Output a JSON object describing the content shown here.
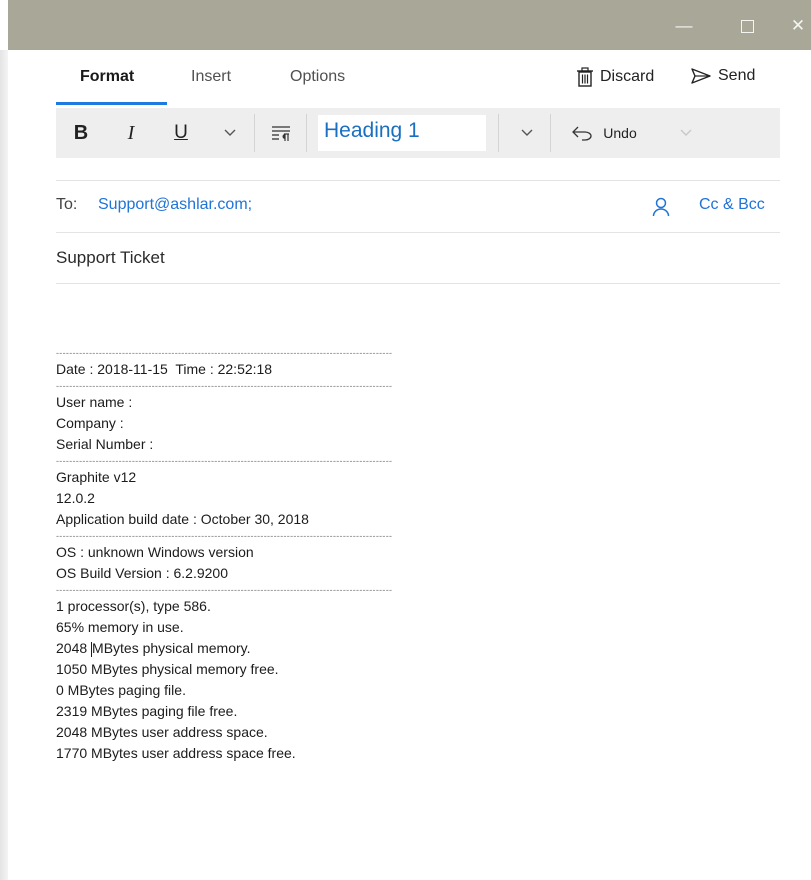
{
  "window": {
    "controls": {
      "minimize": "—",
      "close": "✕"
    }
  },
  "tabs": [
    {
      "label": "Format",
      "active": true
    },
    {
      "label": "Insert",
      "active": false
    },
    {
      "label": "Options",
      "active": false
    }
  ],
  "actions": {
    "discard": "Discard",
    "send": "Send"
  },
  "toolbar": {
    "bold": "B",
    "italic": "I",
    "underline": "U",
    "style_value": "Heading 1",
    "undo": "Undo"
  },
  "compose": {
    "to_label": "To:",
    "to_value": "Support@ashlar.com;",
    "cc_bcc": "Cc & Bcc",
    "subject": "Support Ticket"
  },
  "body": {
    "separator": "------------------------------------------------------------------------------------------------------",
    "date_line": "Date : 2018-11-15  Time : 22:52:18",
    "user_name": "User name :",
    "company": "Company :",
    "serial": "Serial Number :",
    "app_name": "Graphite v12",
    "app_version": "12.0.2",
    "build_date": "Application build date : October 30, 2018",
    "os": "OS : unknown Windows version",
    "os_build": "OS Build Version : 6.2.9200",
    "processors": "1 processor(s), type 586.",
    "memory_in_use": "65% memory in use.",
    "phys_mem_a": "2048 ",
    "phys_mem_b": "MBytes physical memory.",
    "phys_free": "1050 MBytes physical memory free.",
    "paging": "0 MBytes paging file.",
    "paging_free": "2319 MBytes paging file free.",
    "user_space": "2048 MBytes user address space.",
    "user_space_free": "1770 MBytes user address space free."
  },
  "colors": {
    "accent": "#1c7ae0",
    "titlebar": "#a9a898",
    "link": "#1f74d6"
  }
}
